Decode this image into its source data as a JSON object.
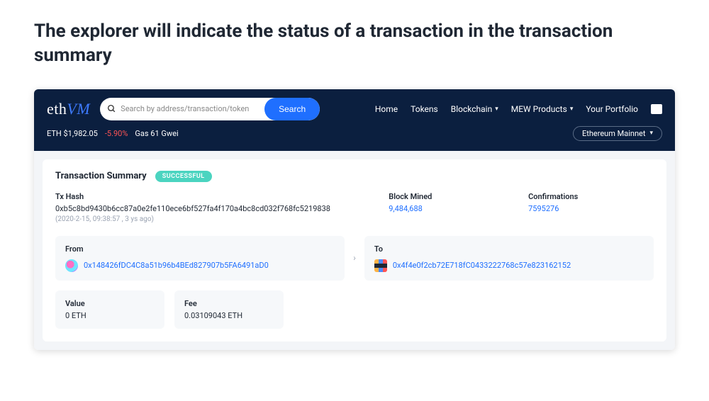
{
  "heading": "The explorer will indicate the status of a transaction in the transaction summary",
  "logo": {
    "eth": "eth",
    "vm": "VM"
  },
  "search": {
    "placeholder": "Search by address/transaction/token",
    "button": "Search"
  },
  "nav": {
    "home": "Home",
    "tokens": "Tokens",
    "blockchain": "Blockchain",
    "mew": "MEW Products",
    "portfolio": "Your Portfolio"
  },
  "stats": {
    "price": "ETH $1,982.05",
    "change": "-5.90%",
    "gas": "Gas 61 Gwei"
  },
  "network": "Ethereum Mainnet",
  "summary": {
    "title": "Transaction Summary",
    "status": "SUCCESSFUL",
    "hash_label": "Tx Hash",
    "hash": "0xb5c8bd9430b6cc87a0e2fe110ece6bf527fa4f170a4bc8cd032f768fc5219838",
    "hash_meta": "(2020-2-15, 09:38:57 , 3 ys ago)",
    "block_label": "Block Mined",
    "block": "9,484,688",
    "conf_label": "Confirmations",
    "conf": "7595276",
    "from_label": "From",
    "from_addr": "0x148426fDC4C8a51b96b4BEd827907b5FA6491aD0",
    "to_label": "To",
    "to_addr": "0x4f4e0f2cb72E718fC0433222768c57e823162152",
    "value_label": "Value",
    "value": "0 ETH",
    "fee_label": "Fee",
    "fee": "0.03109043 ETH"
  }
}
